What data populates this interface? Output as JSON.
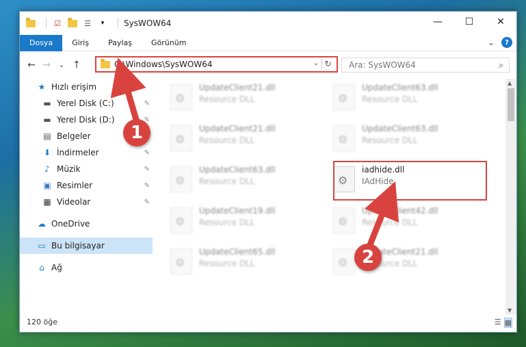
{
  "window": {
    "title": "SysWOW64",
    "controls": {
      "minimize": "—",
      "maximize": "☐",
      "close": "✕"
    }
  },
  "ribbon": {
    "tabs": [
      "Dosya",
      "Giriş",
      "Paylaş",
      "Görünüm"
    ],
    "active_tab": "Dosya",
    "expand": "⌄",
    "help": "?"
  },
  "nav": {
    "back": "←",
    "forward": "→",
    "recent": "⌄",
    "up": "↑",
    "address": "C:\\Windows\\SysWOW64",
    "address_dropdown": "⌄",
    "refresh": "↻",
    "search_placeholder": "Ara: SysWOW64",
    "search_icon": "⌕"
  },
  "sidebar": {
    "items": [
      {
        "label": "Hızlı erişim",
        "icon": "★",
        "icon_name": "star-icon",
        "pinned": false
      },
      {
        "label": "Yerel Disk (C:)",
        "icon": "▬",
        "icon_name": "drive-icon",
        "pinned": true
      },
      {
        "label": "Yerel Disk (D:)",
        "icon": "▬",
        "icon_name": "drive-icon",
        "pinned": true
      },
      {
        "label": "Belgeler",
        "icon": "▤",
        "icon_name": "documents-icon",
        "pinned": true
      },
      {
        "label": "İndirmeler",
        "icon": "⬇",
        "icon_name": "download-icon",
        "pinned": true
      },
      {
        "label": "Müzik",
        "icon": "♪",
        "icon_name": "music-icon",
        "pinned": true
      },
      {
        "label": "Resimler",
        "icon": "▣",
        "icon_name": "pictures-icon",
        "pinned": true
      },
      {
        "label": "Videolar",
        "icon": "▦",
        "icon_name": "videos-icon",
        "pinned": true
      },
      {
        "label": "OneDrive",
        "icon": "☁",
        "icon_name": "cloud-icon",
        "pinned": false
      },
      {
        "label": "Bu bilgisayar",
        "icon": "▭",
        "icon_name": "computer-icon",
        "pinned": false,
        "selected": true
      },
      {
        "label": "Ağ",
        "icon": "⌂",
        "icon_name": "network-icon",
        "pinned": false
      }
    ],
    "pin_glyph": "📌"
  },
  "files": [
    {
      "name": "UpdateClient21.dll",
      "desc": "Resource DLL"
    },
    {
      "name": "UpdateClient63.dll",
      "desc": "Resource DLL"
    },
    {
      "name": "UpdateClient21.dll",
      "desc": "Resource DLL"
    },
    {
      "name": "UpdateClient63.dll",
      "desc": "Resource DLL"
    },
    {
      "name": "UpdateClient63.dll",
      "desc": "Resource DLL"
    },
    {
      "name": "iadhide.dll",
      "desc": "IAdHide",
      "highlight": true
    },
    {
      "name": "UpdateClient19.dll",
      "desc": "Resource DLL"
    },
    {
      "name": "UpdateClient42.dll",
      "desc": "Resource DLL"
    },
    {
      "name": "UpdateClient65.dll",
      "desc": "Resource DLL"
    },
    {
      "name": "UpdateClient21.dll",
      "desc": "Resource DLL"
    }
  ],
  "status": {
    "count": "120 öğe"
  },
  "view_icons": {
    "details": "☰",
    "tiles": "▦"
  },
  "annotations": {
    "step1": "1",
    "step2": "2"
  },
  "colors": {
    "accent": "#1979ca",
    "annotation": "#d9433f"
  }
}
